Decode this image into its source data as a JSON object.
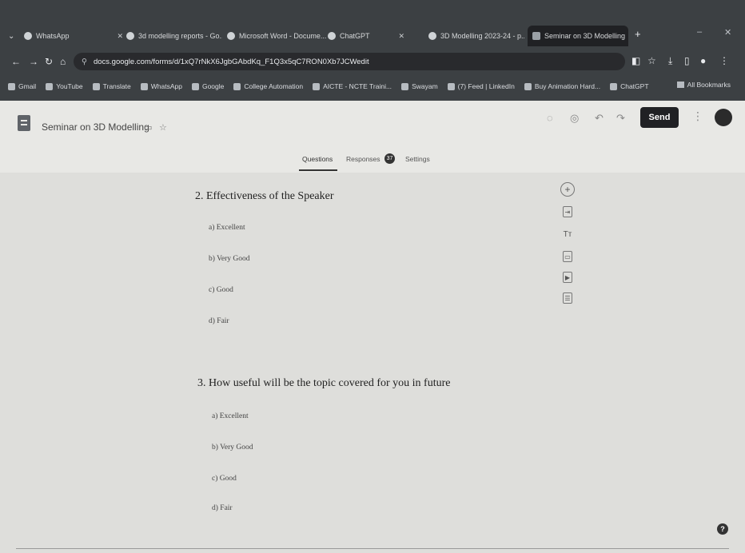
{
  "browser": {
    "tabs": [
      {
        "label": "WhatsApp"
      },
      {
        "label": "3d modelling reports - Go..."
      },
      {
        "label": "Microsoft Word - Docume..."
      },
      {
        "label": "ChatGPT"
      },
      {
        "label": "3D Modelling 2023-24 - p..."
      },
      {
        "label": "Seminar on 3D Modelling"
      }
    ],
    "url": "docs.google.com/forms/d/1xQ7rNkX6JgbGAbdKq_F1Q3x5qC7RON0Xb7JCWedit",
    "bookmarks": [
      "Gmail",
      "YouTube",
      "Translate",
      "WhatsApp",
      "Google",
      "College Automation",
      "AICTE - NCTE Traini...",
      "Swayam",
      "(7) Feed | LinkedIn",
      "Buy Animation Hard...",
      "ChatGPT"
    ],
    "all_bookmarks": "All Bookmarks"
  },
  "forms": {
    "title": "Seminar on 3D Modelling",
    "send_label": "Send",
    "tabs": {
      "questions": "Questions",
      "responses": "Responses",
      "responses_count": "37",
      "settings": "Settings"
    }
  },
  "questions": [
    {
      "title": "2. Effectiveness of the Speaker",
      "options": [
        "a) Excellent",
        "b) Very Good",
        "c) Good",
        "d) Fair"
      ]
    },
    {
      "title": "3. How useful will be the topic covered for you in future",
      "options": [
        "a) Excellent",
        "b) Very Good",
        "c) Good",
        "d) Fair"
      ]
    }
  ],
  "toolbar": {
    "add_question_icon": "+",
    "import_icon": "⇥",
    "title_icon": "Tт",
    "image_icon": "▭",
    "video_icon": "▶",
    "section_icon": "☰"
  },
  "help": "?",
  "colors": {
    "chrome": "#3c4043",
    "send": "#202124",
    "page": "#dededb"
  }
}
